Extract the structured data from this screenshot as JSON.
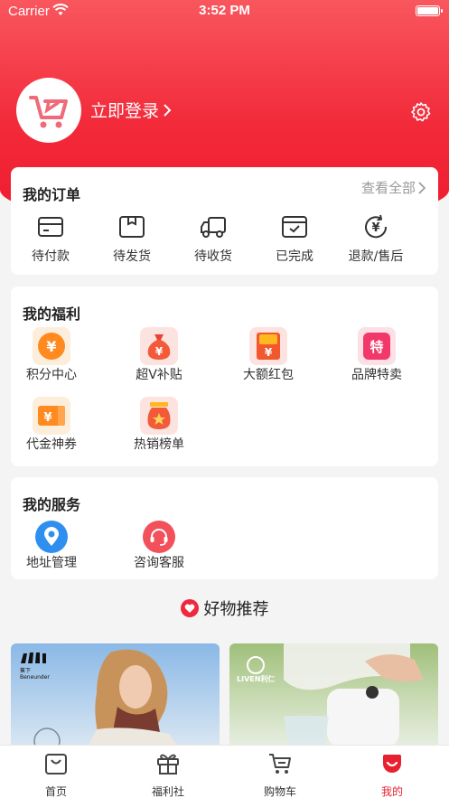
{
  "status_bar": {
    "carrier": "Carrier",
    "time": "3:52 PM"
  },
  "profile": {
    "login_label": "立即登录"
  },
  "orders": {
    "title": "我的订单",
    "view_all": "查看全部",
    "items": [
      {
        "label": "待付款",
        "icon": "wallet-icon"
      },
      {
        "label": "待发货",
        "icon": "package-icon"
      },
      {
        "label": "待收货",
        "icon": "truck-icon"
      },
      {
        "label": "已完成",
        "icon": "completed-icon"
      },
      {
        "label": "退款/售后",
        "icon": "refund-icon"
      }
    ]
  },
  "welfare": {
    "title": "我的福利",
    "items": [
      {
        "label": "积分中心",
        "icon": "points-coin-icon"
      },
      {
        "label": "超V补贴",
        "icon": "money-bag-icon"
      },
      {
        "label": "大额红包",
        "icon": "red-envelope-icon"
      },
      {
        "label": "品牌特卖",
        "icon": "special-sale-icon",
        "glyph": "特"
      },
      {
        "label": "代金神券",
        "icon": "coupon-icon"
      },
      {
        "label": "热销榜单",
        "icon": "hot-list-icon"
      }
    ]
  },
  "services": {
    "title": "我的服务",
    "items": [
      {
        "label": "地址管理",
        "icon": "location-pin-icon"
      },
      {
        "label": "咨询客服",
        "icon": "headset-icon"
      }
    ]
  },
  "recommend": {
    "title": "好物推荐",
    "products": [
      {
        "brand": "Beneunder",
        "brand_cn": "蕉下"
      },
      {
        "brand": "LIVEN",
        "brand_cn": "利仁"
      }
    ]
  },
  "tabbar": {
    "items": [
      {
        "label": "首页",
        "icon": "shopping-bag-icon"
      },
      {
        "label": "福利社",
        "icon": "gift-icon"
      },
      {
        "label": "购物车",
        "icon": "cart-icon"
      },
      {
        "label": "我的",
        "icon": "profile-smile-icon",
        "active": true
      }
    ]
  },
  "colors": {
    "brand": "#f0283c",
    "background": "#f4f4f4",
    "muted": "#999999"
  }
}
